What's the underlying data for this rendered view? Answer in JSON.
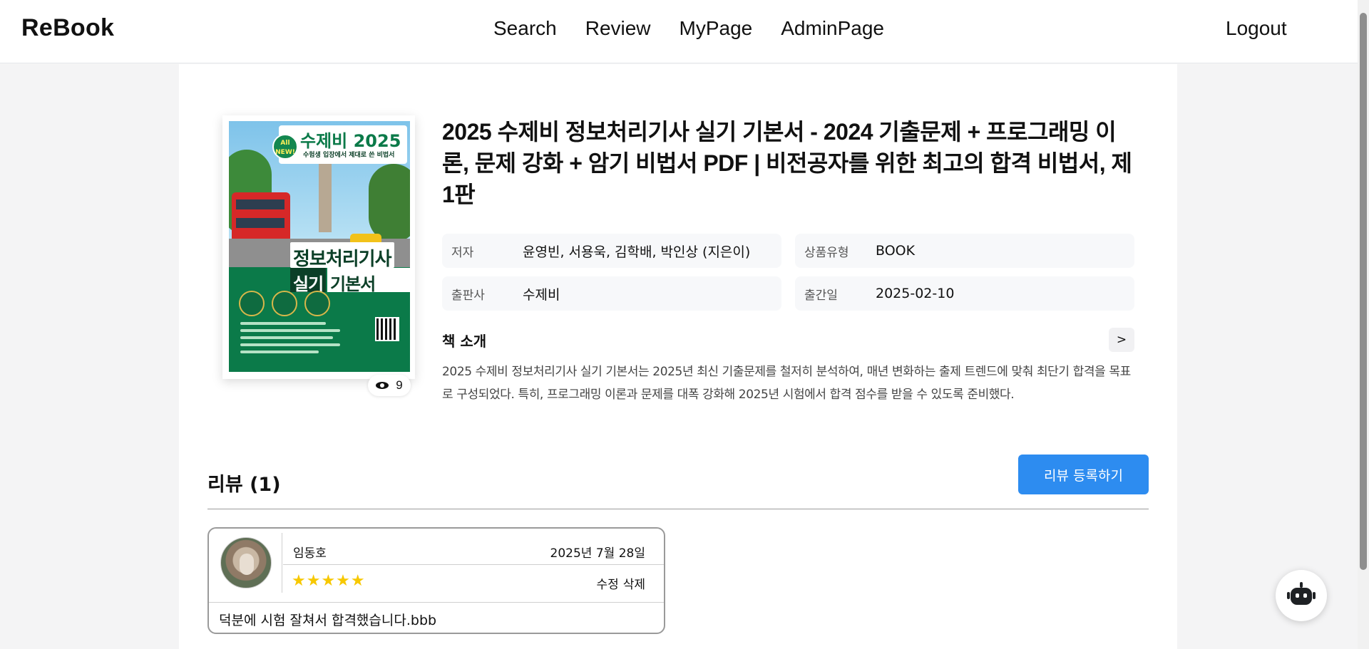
{
  "header": {
    "logo": "ReBook",
    "nav": [
      "Search",
      "Review",
      "MyPage",
      "AdminPage"
    ],
    "logout": "Logout"
  },
  "book": {
    "title": "2025 수제비 정보처리기사 실기 기본서 - 2024 기출문제 + 프로그래밍 이론, 문제 강화 + 암기 비법서 PDF | 비전공자를 위한 최고의 합격 비법서, 제1판",
    "views": "9",
    "cover": {
      "brand": "수제비 2025",
      "brand_sub": "수험생 입장에서 제대로 쓴 비법서",
      "badge": "All NEW!",
      "title_line1": "정보처리기사",
      "title_line2a": "실기",
      "title_line2b": "기본서"
    },
    "meta": [
      {
        "label": "저자",
        "value": "윤영빈, 서용욱, 김학배, 박인상 (지은이)"
      },
      {
        "label": "상품유형",
        "value": "BOOK"
      },
      {
        "label": "출판사",
        "value": "수제비"
      },
      {
        "label": "출간일",
        "value": "2025-02-10"
      }
    ],
    "intro_heading": "책 소개",
    "intro_more": ">",
    "intro_text": "2025 수제비 정보처리기사 실기 기본서는 2025년 최신 기출문제를 철저히 분석하여, 매년 변화하는 출제 트렌드에 맞춰 최단기 합격을 목표로 구성되었다. 특히, 프로그래밍 이론과 문제를 대폭 강화해 2025년 시험에서 합격 점수를 받을 수 있도록 준비했다."
  },
  "reviews": {
    "heading": "리뷰 (1)",
    "add_button": "리뷰 등록하기",
    "items": [
      {
        "author": "임동호",
        "date": "2025년 7월 28일",
        "rating": 5,
        "stars": "★★★★★",
        "edit": "수정",
        "delete": "삭제",
        "body": "덕분에 시험 잘쳐서 합격했습니다.bbb"
      }
    ]
  },
  "icons": {
    "views": "eye-icon",
    "chatbot": "robot-icon"
  }
}
